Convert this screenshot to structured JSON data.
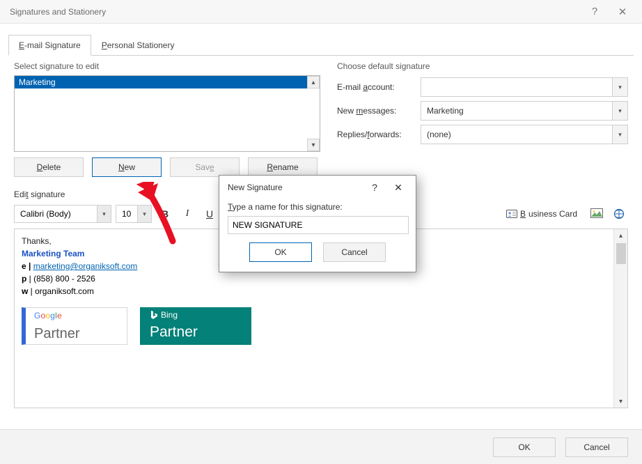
{
  "window": {
    "title": "Signatures and Stationery",
    "help_symbol": "?",
    "close_symbol": "✕"
  },
  "tabs": {
    "email": "E-mail Signature",
    "personal": "Personal Stationery"
  },
  "left": {
    "select_label": "Select signature to edit",
    "items": [
      "Marketing"
    ],
    "buttons": {
      "delete": "Delete",
      "new": "New",
      "save": "Save",
      "rename": "Rename"
    }
  },
  "right": {
    "choose_label": "Choose default signature",
    "email_account_label": "E-mail account:",
    "email_account_value": "",
    "new_messages_label": "New messages:",
    "new_messages_value": "Marketing",
    "replies_label": "Replies/forwards:",
    "replies_value": "(none)"
  },
  "edit_label": "Edit signature",
  "toolbar": {
    "font": "Calibri (Body)",
    "size": "10",
    "bold": "B",
    "italic": "I",
    "underline": "U",
    "business_card": "Business Card"
  },
  "signature_content": {
    "line1": "Thanks,",
    "line2": "Marketing Team",
    "line3_prefix": "e | ",
    "line3_link": "marketing@organiksoft.com",
    "line4": "p | (858) 800 - 2526",
    "line5": "w | organiksoft.com",
    "google_partner": "Partner",
    "bing": "Bing",
    "bing_partner": "Partner"
  },
  "footer": {
    "ok": "OK",
    "cancel": "Cancel"
  },
  "modal": {
    "title": "New Signature",
    "help_symbol": "?",
    "close_symbol": "✕",
    "prompt": "Type a name for this signature:",
    "value": "NEW SIGNATURE",
    "ok": "OK",
    "cancel": "Cancel"
  }
}
